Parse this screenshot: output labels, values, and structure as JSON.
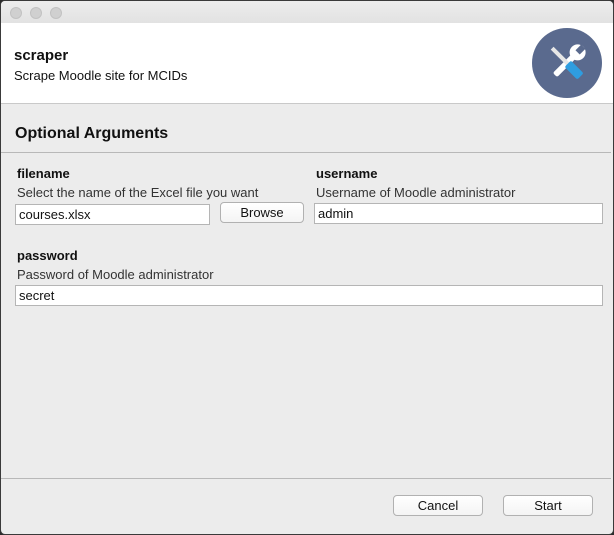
{
  "window": {
    "title_bar_buttons": [
      "close",
      "minimize",
      "zoom"
    ]
  },
  "header": {
    "title": "scraper",
    "subtitle": "Scrape Moodle site for MCIDs",
    "icon": "tools-icon",
    "icon_color": "#5a6a8e"
  },
  "section": {
    "title": "Optional Arguments"
  },
  "fields": {
    "filename": {
      "label": "filename",
      "help": "Select the name of the Excel file you want",
      "value": "courses.xlsx",
      "browse_label": "Browse"
    },
    "username": {
      "label": "username",
      "help": "Username of Moodle administrator",
      "value": "admin"
    },
    "password": {
      "label": "password",
      "help": "Password of Moodle administrator",
      "value": "secret"
    }
  },
  "footer": {
    "cancel_label": "Cancel",
    "start_label": "Start"
  }
}
